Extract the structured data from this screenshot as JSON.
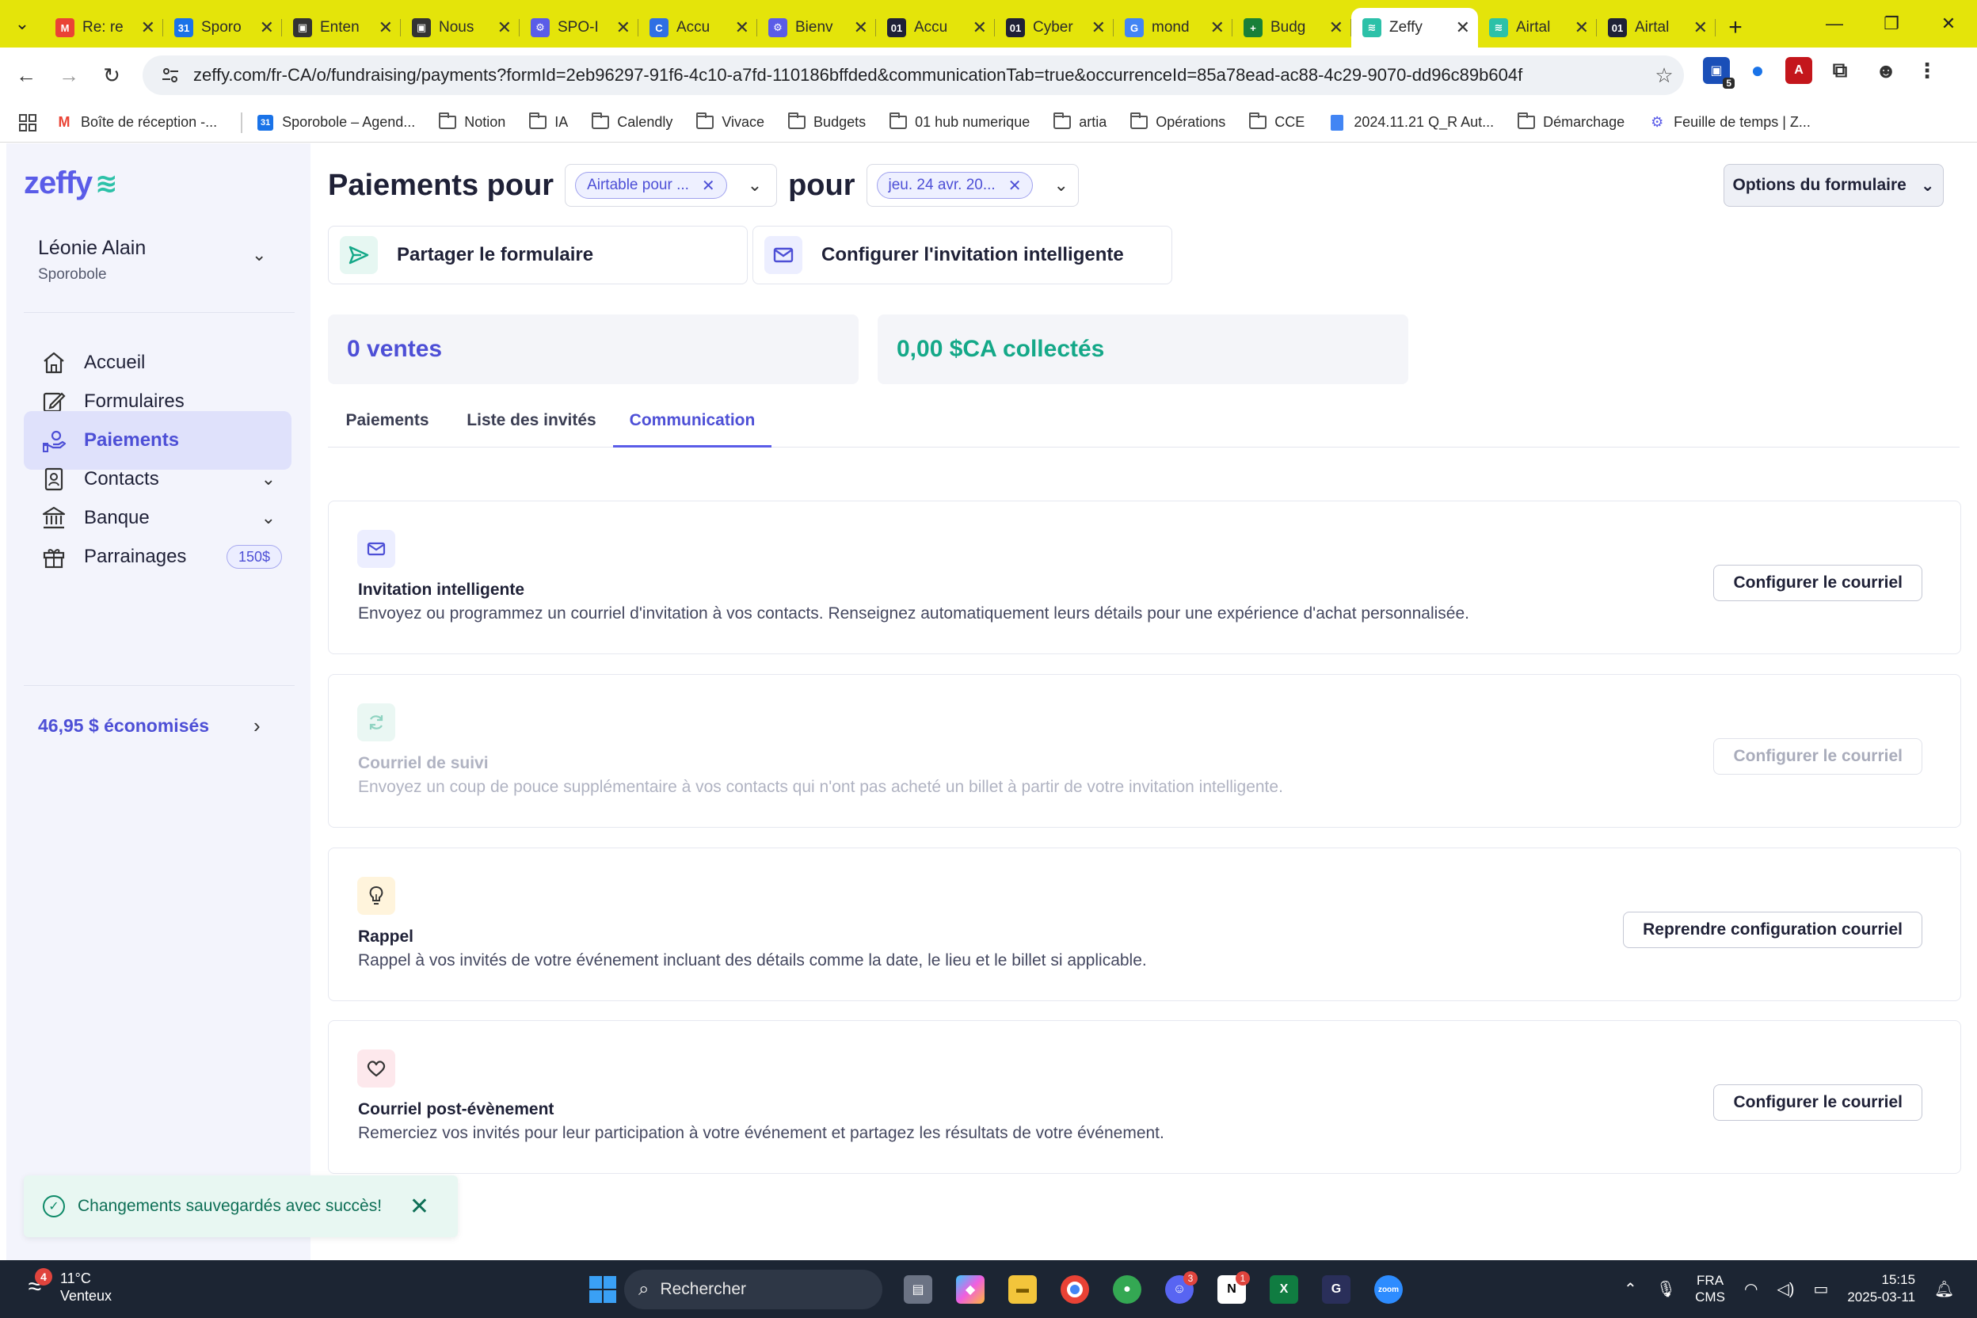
{
  "browser": {
    "tabs": [
      {
        "title": "Re: re",
        "favicon": "gmail-icon",
        "color": "#ea4335",
        "glyph": "M"
      },
      {
        "title": "Sporo",
        "favicon": "calendar-icon",
        "color": "#1a73e8",
        "glyph": "31"
      },
      {
        "title": "Enten",
        "favicon": "film-icon",
        "color": "#333333",
        "glyph": "▣"
      },
      {
        "title": "Nous",
        "favicon": "film-icon",
        "color": "#333333",
        "glyph": "▣"
      },
      {
        "title": "SPO-I",
        "favicon": "zeffy-icon",
        "color": "#5a5ce8",
        "glyph": "⚙"
      },
      {
        "title": "Accu",
        "favicon": "c-icon",
        "color": "#2f6fe4",
        "glyph": "C"
      },
      {
        "title": "Bienv",
        "favicon": "zeffy-icon",
        "color": "#5a5ce8",
        "glyph": "⚙"
      },
      {
        "title": "Accu",
        "favicon": "01-icon",
        "color": "#1f2137",
        "glyph": "01"
      },
      {
        "title": "Cyber",
        "favicon": "01-icon",
        "color": "#1f2137",
        "glyph": "01"
      },
      {
        "title": "mond",
        "favicon": "google-icon",
        "color": "#4285f4",
        "glyph": "G"
      },
      {
        "title": "Budg",
        "favicon": "sheets-icon",
        "color": "#188038",
        "glyph": "+"
      },
      {
        "title": "Zeffy",
        "favicon": "zeffy-icon",
        "color": "#2cc1a8",
        "glyph": "≋",
        "active": true
      },
      {
        "title": "Airtal",
        "favicon": "zeffy-icon",
        "color": "#2cc1a8",
        "glyph": "≋"
      },
      {
        "title": "Airtal",
        "favicon": "01-icon",
        "color": "#1f2137",
        "glyph": "01"
      }
    ],
    "url": "zeffy.com/fr-CA/o/fundraising/payments?formId=2eb96297-91f6-4c10-a7fd-110186bffded&communicationTab=true&occurrenceId=85a78ead-ac88-4c29-9070-dd96c89b604f",
    "extension_badge": "5",
    "bookmarks": [
      {
        "label": "Boîte de réception -...",
        "icon": "gmail-icon"
      },
      {
        "label": "Sporobole – Agend...",
        "icon": "calendar-icon"
      },
      {
        "label": "Notion",
        "icon": "folder-icon"
      },
      {
        "label": "IA",
        "icon": "folder-icon"
      },
      {
        "label": "Calendly",
        "icon": "folder-icon"
      },
      {
        "label": "Vivace",
        "icon": "folder-icon"
      },
      {
        "label": "Budgets",
        "icon": "folder-icon"
      },
      {
        "label": "01 hub numerique",
        "icon": "folder-icon"
      },
      {
        "label": "artia",
        "icon": "folder-icon"
      },
      {
        "label": "Opérations",
        "icon": "folder-icon"
      },
      {
        "label": "CCE",
        "icon": "folder-icon"
      },
      {
        "label": "2024.11.21 Q_R Aut...",
        "icon": "docs-icon"
      },
      {
        "label": "Démarchage",
        "icon": "folder-icon"
      },
      {
        "label": "Feuille de temps | Z...",
        "icon": "zeffy-icon"
      }
    ]
  },
  "sidebar": {
    "logo": "zeffy",
    "user_name": "Léonie Alain",
    "user_org": "Sporobole",
    "items": [
      {
        "label": "Accueil",
        "icon": "home-icon"
      },
      {
        "label": "Formulaires",
        "icon": "edit-icon"
      },
      {
        "label": "Paiements",
        "icon": "payment-hand-icon",
        "active": true
      },
      {
        "label": "Contacts",
        "icon": "contacts-icon",
        "expandable": true
      },
      {
        "label": "Banque",
        "icon": "bank-icon",
        "expandable": true
      },
      {
        "label": "Parrainages",
        "icon": "gift-icon",
        "badge": "150$"
      }
    ],
    "savings": "46,95 $ économisés"
  },
  "main": {
    "title_prefix": "Paiements pour",
    "form_chip": "Airtable pour ...",
    "title_mid": "pour",
    "date_chip": "jeu. 24 avr. 20...",
    "options_button": "Options du formulaire",
    "share_label": "Partager le formulaire",
    "invite_label": "Configurer l'invitation intelligente",
    "sales": "0 ventes",
    "collected": "0,00 $CA collectés",
    "tabs": [
      "Paiements",
      "Liste des invités",
      "Communication"
    ],
    "active_tab": "Communication",
    "cards": [
      {
        "title": "Invitation intelligente",
        "desc": "Envoyez ou programmez un courriel d'invitation à vos contacts. Renseignez automatiquement leurs détails pour une expérience d'achat personnalisée.",
        "button": "Configurer le courriel",
        "icon": "mail-icon",
        "disabled": false
      },
      {
        "title": "Courriel de suivi",
        "desc": "Envoyez un coup de pouce supplémentaire à vos contacts qui n'ont pas acheté un billet à partir de votre invitation intelligente.",
        "button": "Configurer le courriel",
        "icon": "refresh-icon",
        "disabled": true
      },
      {
        "title": "Rappel",
        "desc": "Rappel à vos invités de votre événement incluant des détails comme la date, le lieu et le billet si applicable.",
        "button": "Reprendre configuration courriel",
        "icon": "lightbulb-icon",
        "disabled": false
      },
      {
        "title": "Courriel post-évènement",
        "desc": "Remerciez vos invités pour leur participation à votre événement et partagez les résultats de votre événement.",
        "button": "Configurer le courriel",
        "icon": "heart-icon",
        "disabled": false
      }
    ]
  },
  "toast": {
    "text": "Changements sauvegardés avec succès!"
  },
  "taskbar": {
    "weather_temp": "11°C",
    "weather_desc": "Venteux",
    "weather_badge": "4",
    "search_placeholder": "Rechercher",
    "lang_top": "FRA",
    "lang_bottom": "CMS",
    "time": "15:15",
    "date": "2025-03-11",
    "discord_badge": "3",
    "notion_badge": "1"
  },
  "colors": {
    "accent": "#5a5ce8",
    "accent_text": "#4d4fd6",
    "green": "#14a888",
    "tabstrip": "#e4e40a"
  }
}
